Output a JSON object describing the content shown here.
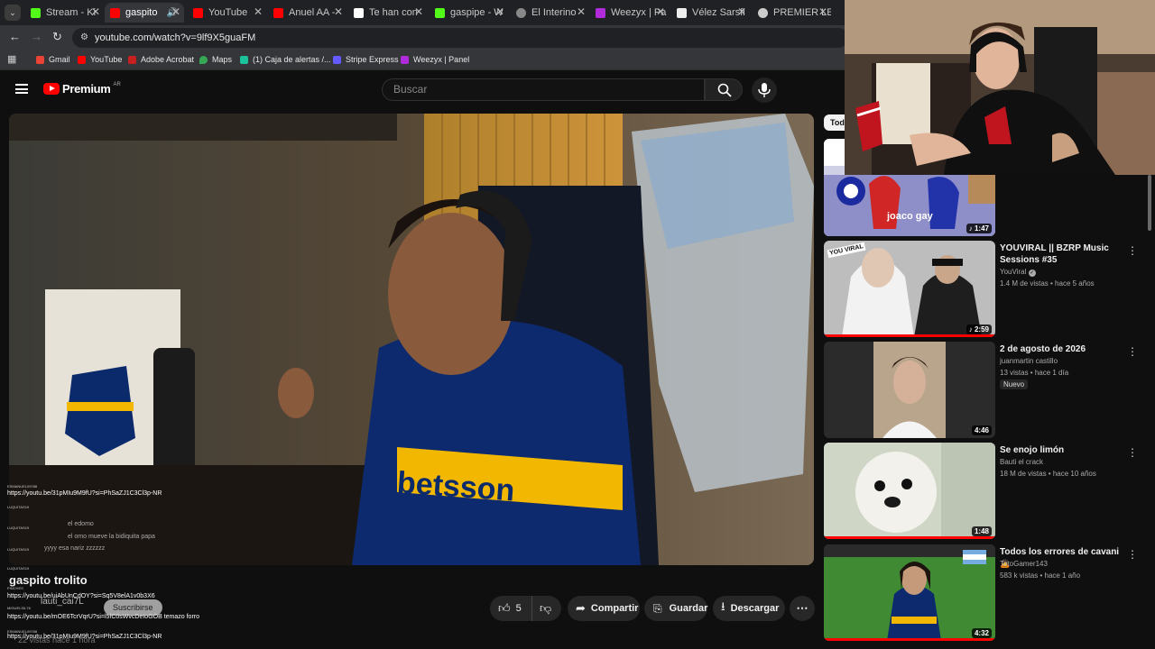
{
  "browser": {
    "tabs": [
      {
        "label": "Stream - Ki",
        "fav": "#53fc18"
      },
      {
        "label": "gaspito",
        "fav": "#ff0000"
      },
      {
        "label": "YouTube",
        "fav": "#ff0000"
      },
      {
        "label": "Anuel AA -",
        "fav": "#ff0000"
      },
      {
        "label": "Te han con",
        "fav": "#ffffff"
      },
      {
        "label": "gaspipe - W",
        "fav": "#53fc18"
      },
      {
        "label": "El Interino",
        "fav": "#888888"
      },
      {
        "label": "Weezyx | Pa",
        "fav": "#b02bd9"
      },
      {
        "label": "Vélez Sarsfi",
        "fav": "#ffffff"
      },
      {
        "label": "PREMIER LE",
        "fav": "#cccccc"
      }
    ],
    "url": "youtube.com/watch?v=9lf9X5guaFM",
    "bookmarks": [
      "Gmail",
      "YouTube",
      "Adobe Acrobat",
      "Maps",
      "(1) Caja de alertas /...",
      "Stripe Express",
      "Weezyx | Panel"
    ]
  },
  "youtube": {
    "logo_text": "Premium",
    "logo_region": "AR",
    "search_placeholder": "Buscar",
    "filter_chip": "Tod"
  },
  "video": {
    "title": "gaspito trolito",
    "likes": "5",
    "share_label": "Compartir",
    "save_label": "Guardar",
    "download_label": "Descargar",
    "subscribe_label": "Suscribirse",
    "channel_hint": "lauti_cai7L",
    "views_hint": "22 vistas hace 1 hora"
  },
  "chat": [
    {
      "user": "ESMANUEL09788",
      "text": "https://youtu.be/31pMIu9M9fU?si=PhSaZJ1C3Cl3p-NR"
    },
    {
      "user": "LUQUITAS19",
      "text": "el edomo"
    },
    {
      "user": "LUQUITAS19",
      "text": "el omo mueve la bidiquita papa"
    },
    {
      "user": "LUQUITAS19",
      "text": "yyyy esa nariz zzzzzz"
    },
    {
      "user": "LUQUITAS19",
      "text": ""
    },
    {
      "user": "PINCHES",
      "text": "https://youtu.be/uiAbUnCdOY?si=Sq5V8elA1v0b3X6"
    },
    {
      "user": "MIGUELSIL76",
      "text": "https://youtu.be/mOE6TcrVqrU?si=l5fC0sWvcDeIoGOB temazo forro"
    },
    {
      "user": "ESMANUEL09788",
      "text": "https://youtu.be/31pMIu9M9fU?si=PhSaZJ1C3Cl3p-NR"
    }
  ],
  "recommendations": [
    {
      "title": "",
      "channel": "",
      "meta": "",
      "duration": "1:47",
      "overlay": "joaco gay",
      "badge": ""
    },
    {
      "title": "YOUVIRAL || BZRP Music Sessions #35",
      "channel": "YouViral",
      "meta": "1.4 M de vistas • hace 5 años",
      "duration": "2:59",
      "overlay": "",
      "badge": ""
    },
    {
      "title": "2 de agosto de 2026",
      "channel": "juanmartin castillo",
      "meta": "13 vistas • hace 1 día",
      "duration": "4:46",
      "overlay": "",
      "badge": "Nuevo"
    },
    {
      "title": "Se enojo limón",
      "channel": "Bauti el crack",
      "meta": "18 M de vistas • hace 10 años",
      "duration": "1:48",
      "overlay": "",
      "badge": ""
    },
    {
      "title": "Todos los errores de cavani",
      "channel": "TotoGamer143",
      "meta": "583 k vistas • hace 1 año",
      "duration": "4:32",
      "overlay": "",
      "badge": ""
    }
  ],
  "colors": {
    "accent": "#ff0000",
    "boca_blue": "#0b2a6b",
    "boca_gold": "#f2b700"
  }
}
